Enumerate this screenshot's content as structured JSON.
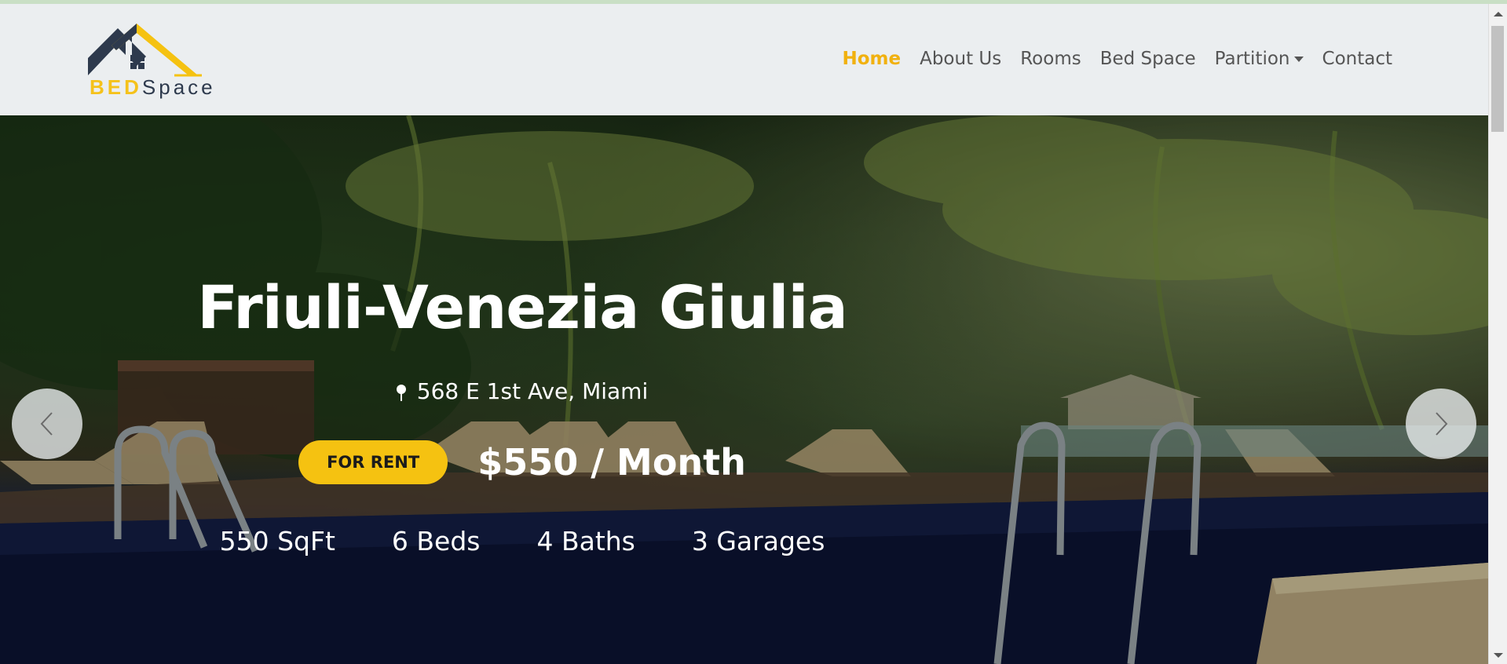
{
  "brand": {
    "logo_bed": "BED",
    "logo_space": "Space",
    "accent_color": "#f5c211",
    "dark_color": "#2e3a4d"
  },
  "nav": {
    "items": [
      {
        "label": "Home",
        "active": true
      },
      {
        "label": "About Us",
        "active": false
      },
      {
        "label": "Rooms",
        "active": false
      },
      {
        "label": "Bed Space",
        "active": false
      },
      {
        "label": "Partition",
        "active": false,
        "dropdown": true
      },
      {
        "label": "Contact",
        "active": false
      }
    ]
  },
  "hero": {
    "title": "Friuli-Venezia Giulia",
    "address_icon": "map-pin-icon",
    "address": "568 E 1st Ave, Miami",
    "badge": "FOR RENT",
    "price": "$550 / Month",
    "features": [
      "550 SqFt",
      "6 Beds",
      "4 Baths",
      "3 Garages"
    ],
    "prev_icon": "chevron-left-icon",
    "next_icon": "chevron-right-icon"
  }
}
